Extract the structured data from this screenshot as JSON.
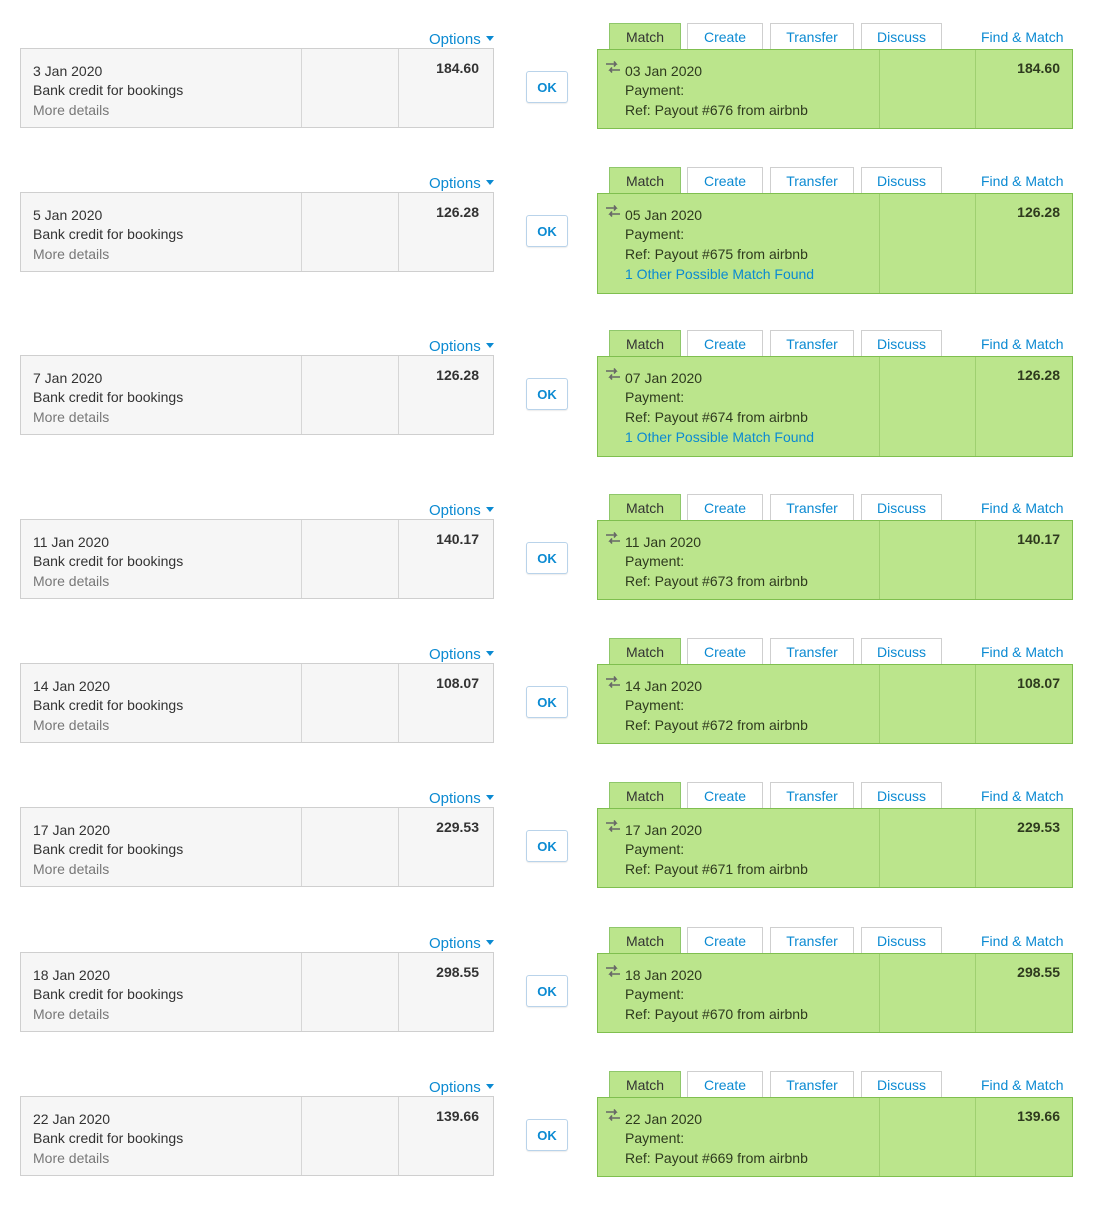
{
  "labels": {
    "options": "Options",
    "more_details": "More details",
    "ok": "OK",
    "tab_match": "Match",
    "tab_create": "Create",
    "tab_transfer": "Transfer",
    "tab_discuss": "Discuss",
    "find_match": "Find & Match",
    "payment": "Payment:",
    "other_match": "1 Other Possible Match Found"
  },
  "icons": {
    "options_caret": "caret-down-icon",
    "match_type": "transfer-arrows-icon"
  },
  "colors": {
    "accent": "#0b8ad2",
    "match_bg": "#bbe58c",
    "match_border": "#7fbf4f",
    "statement_bg": "#f6f6f6"
  },
  "rows": [
    {
      "stmt_date": "3 Jan 2020",
      "stmt_desc": "Bank credit for bookings",
      "stmt_amount": "184.60",
      "match_date": "03 Jan 2020",
      "match_ref": "Ref: Payout #676 from airbnb",
      "match_amount": "184.60",
      "other_match": false
    },
    {
      "stmt_date": "5 Jan 2020",
      "stmt_desc": "Bank credit for bookings",
      "stmt_amount": "126.28",
      "match_date": "05 Jan 2020",
      "match_ref": "Ref: Payout #675 from airbnb",
      "match_amount": "126.28",
      "other_match": true
    },
    {
      "stmt_date": "7 Jan 2020",
      "stmt_desc": "Bank credit for bookings",
      "stmt_amount": "126.28",
      "match_date": "07 Jan 2020",
      "match_ref": "Ref: Payout #674 from airbnb",
      "match_amount": "126.28",
      "other_match": true
    },
    {
      "stmt_date": "11 Jan 2020",
      "stmt_desc": "Bank credit for bookings",
      "stmt_amount": "140.17",
      "match_date": "11 Jan 2020",
      "match_ref": "Ref: Payout #673 from airbnb",
      "match_amount": "140.17",
      "other_match": false
    },
    {
      "stmt_date": "14 Jan 2020",
      "stmt_desc": "Bank credit for bookings",
      "stmt_amount": "108.07",
      "match_date": "14 Jan 2020",
      "match_ref": "Ref: Payout #672 from airbnb",
      "match_amount": "108.07",
      "other_match": false
    },
    {
      "stmt_date": "17 Jan 2020",
      "stmt_desc": "Bank credit for bookings",
      "stmt_amount": "229.53",
      "match_date": "17 Jan 2020",
      "match_ref": "Ref: Payout #671 from airbnb",
      "match_amount": "229.53",
      "other_match": false
    },
    {
      "stmt_date": "18 Jan 2020",
      "stmt_desc": "Bank credit for bookings",
      "stmt_amount": "298.55",
      "match_date": "18 Jan 2020",
      "match_ref": "Ref: Payout #670 from airbnb",
      "match_amount": "298.55",
      "other_match": false
    },
    {
      "stmt_date": "22 Jan 2020",
      "stmt_desc": "Bank credit for bookings",
      "stmt_amount": "139.66",
      "match_date": "22 Jan 2020",
      "match_ref": "Ref: Payout #669 from airbnb",
      "match_amount": "139.66",
      "other_match": false
    }
  ]
}
